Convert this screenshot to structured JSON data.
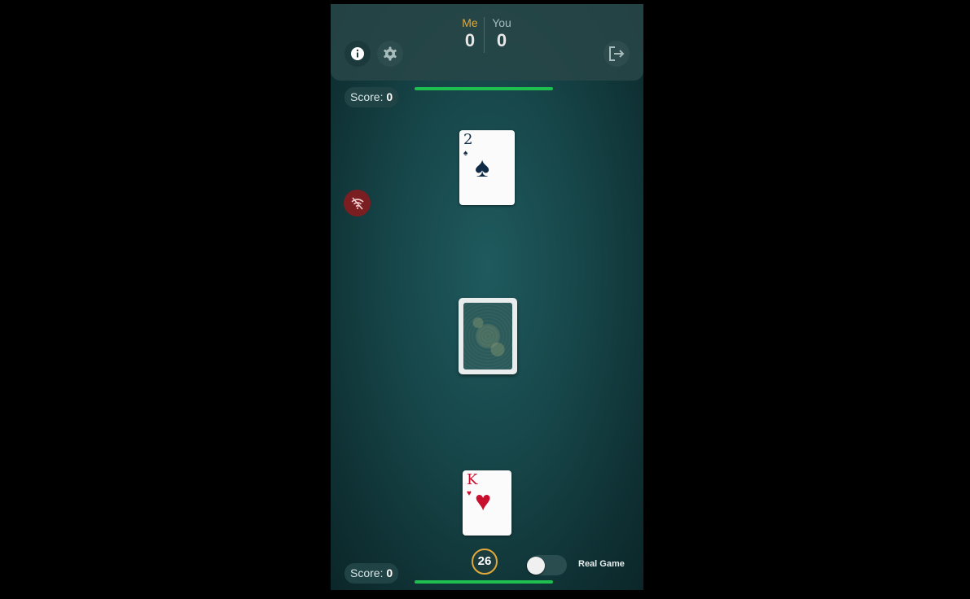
{
  "scoreboard": {
    "me_label": "Me",
    "you_label": "You",
    "me_score": "0",
    "you_score": "0"
  },
  "opponent": {
    "score_label": "Score:",
    "score_value": "0",
    "card": {
      "rank": "2",
      "suit": "♠",
      "suit_name": "spades"
    },
    "connection_status": "offline"
  },
  "player": {
    "score_label": "Score:",
    "score_value": "0",
    "card": {
      "rank": "K",
      "suit": "♥",
      "suit_name": "hearts"
    }
  },
  "deck": {
    "remaining": "26"
  },
  "real_game": {
    "label": "Real Game",
    "enabled": false
  },
  "icons": {
    "info": "info-icon",
    "settings": "gear-icon",
    "exit": "exit-icon",
    "offline": "wifi-off-icon"
  },
  "colors": {
    "accent": "#e0a93a",
    "timer": "#1fbf4f",
    "card_black": "#0e2a44",
    "card_red": "#c8102e",
    "offline_badge": "#7a1e22"
  }
}
